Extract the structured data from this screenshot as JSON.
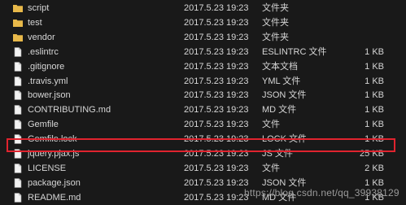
{
  "files": [
    {
      "icon": "folder-icon",
      "name": "script",
      "date": "2017.5.23 19:23",
      "type": "文件夹",
      "size": ""
    },
    {
      "icon": "folder-icon",
      "name": "test",
      "date": "2017.5.23 19:23",
      "type": "文件夹",
      "size": ""
    },
    {
      "icon": "folder-icon",
      "name": "vendor",
      "date": "2017.5.23 19:23",
      "type": "文件夹",
      "size": ""
    },
    {
      "icon": "file-icon",
      "name": ".eslintrc",
      "date": "2017.5.23 19:23",
      "type": "ESLINTRC 文件",
      "size": "1 KB"
    },
    {
      "icon": "file-icon",
      "name": ".gitignore",
      "date": "2017.5.23 19:23",
      "type": "文本文档",
      "size": "1 KB"
    },
    {
      "icon": "file-icon",
      "name": ".travis.yml",
      "date": "2017.5.23 19:23",
      "type": "YML 文件",
      "size": "1 KB"
    },
    {
      "icon": "file-icon",
      "name": "bower.json",
      "date": "2017.5.23 19:23",
      "type": "JSON 文件",
      "size": "1 KB"
    },
    {
      "icon": "file-icon",
      "name": "CONTRIBUTING.md",
      "date": "2017.5.23 19:23",
      "type": "MD 文件",
      "size": "1 KB"
    },
    {
      "icon": "file-icon",
      "name": "Gemfile",
      "date": "2017.5.23 19:23",
      "type": "文件",
      "size": "1 KB"
    },
    {
      "icon": "file-icon",
      "name": "Gemfile.lock",
      "date": "2017.5.23 19:23",
      "type": "LOCK 文件",
      "size": "1 KB"
    },
    {
      "icon": "file-icon",
      "name": "jquery.pjax.js",
      "date": "2017.5.23 19:23",
      "type": "JS 文件",
      "size": "25 KB",
      "highlighted": true
    },
    {
      "icon": "file-icon",
      "name": "LICENSE",
      "date": "2017.5.23 19:23",
      "type": "文件",
      "size": "2 KB"
    },
    {
      "icon": "file-icon",
      "name": "package.json",
      "date": "2017.5.23 19:23",
      "type": "JSON 文件",
      "size": "1 KB"
    },
    {
      "icon": "file-icon",
      "name": "README.md",
      "date": "2017.5.23 19:23",
      "type": "MD 文件",
      "size": "1 KB"
    }
  ],
  "watermark": "https://blog.csdn.net/qq_39938129",
  "colors": {
    "background": "#191919",
    "text": "#d6d6d6",
    "folder": "#e8b94a",
    "highlight_border": "#e0232e"
  }
}
